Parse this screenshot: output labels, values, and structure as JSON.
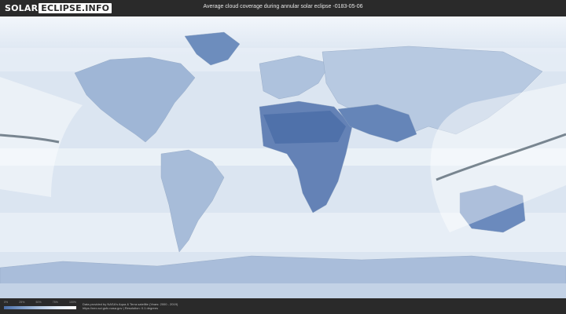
{
  "header": {
    "logo_part1": "SOLAR",
    "logo_part2": "ECLIPSE.INFO",
    "title": "Average cloud coverage during annular solar eclipse -0183-05-06"
  },
  "legend": {
    "ticks": [
      "0%",
      "25%",
      "50%",
      "75%",
      "100%"
    ],
    "colors": [
      "#4a6ea8",
      "#7d9cc8",
      "#b5c9e2",
      "#e6eef7",
      "#ffffff"
    ]
  },
  "footer": {
    "credit_line1": "Data provided by NASA's Aqua & Terra satellite (Years: 2000 - 2019)",
    "credit_line2": "https://neo.sci.gsfc.nasa.gov | Resolution: 0.1 degrees"
  },
  "map": {
    "ocean_color": "#dbe5f1",
    "cloud_dense_color": "#f4f8fc",
    "clear_sky_color": "#5a7db4",
    "visibility_zone_color": "#ffffff",
    "eclipse_path_color": "#5b6a76"
  }
}
